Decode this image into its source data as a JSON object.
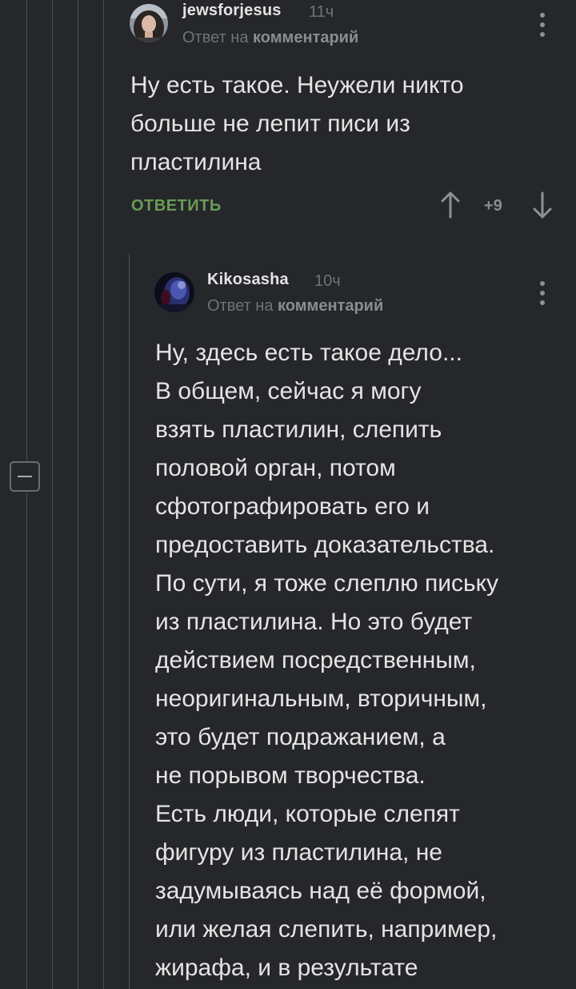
{
  "comments": [
    {
      "username": "jewsforjesus",
      "time": "11ч",
      "reply_prefix": "Ответ на ",
      "reply_link": "комментарий",
      "text": "Ну есть такое. Неужели никто\nбольше не лепит писи из\nпластилина",
      "reply_label": "ОТВЕТИТЬ",
      "score": "+9",
      "avatar": "girl-photo"
    },
    {
      "username": "Kikosasha",
      "time": "10ч",
      "reply_prefix": "Ответ на ",
      "reply_link": "комментарий",
      "text": "Ну, здесь есть такое дело...\nВ общем, сейчас я могу\nвзять пластилин, слепить\nполовой орган, потом\nсфотографировать его и\nпредоставить доказательства.\nПо сути, я тоже слеплю письку\nиз пластилина. Но это будет\nдействием посредственным,\nнеоригинальным, вторичным,\nэто будет подражанием, а\nне порывом творчества.\nЕсть люди, которые слепят\nфигуру из пластилина, не\nзадумываясь над её формой,\nили желая слепить, например,\nжирафа, и в результате",
      "avatar": "dark-blue-face"
    }
  ],
  "icons": {
    "upvote": "arrow-up-icon",
    "downvote": "arrow-down-icon",
    "menu": "kebab-menu-icon",
    "collapse": "minus-icon"
  },
  "colors": {
    "background": "#25272a",
    "text": "#e4e4e4",
    "muted": "#707276",
    "reply_green": "#6b9b57",
    "thread_line": "#4a4c50"
  }
}
